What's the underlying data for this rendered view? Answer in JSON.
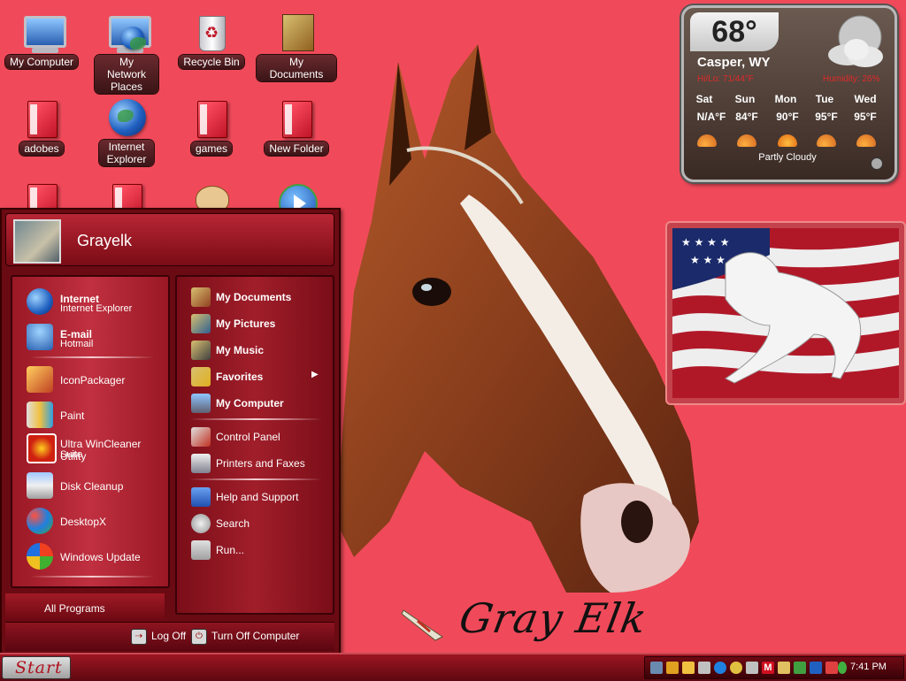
{
  "desktop": {
    "icons": [
      {
        "label": "My Computer",
        "icon": "computer-icon"
      },
      {
        "label": "My Network Places",
        "icon": "network-places-icon"
      },
      {
        "label": "Recycle Bin",
        "icon": "recycle-bin-icon"
      },
      {
        "label": "My Documents",
        "icon": "documents-icon"
      },
      {
        "label": "adobes",
        "icon": "folder-icon"
      },
      {
        "label": "Internet Explorer",
        "icon": "globe-icon"
      },
      {
        "label": "games",
        "icon": "folder-icon"
      },
      {
        "label": "New Folder",
        "icon": "folder-icon"
      }
    ],
    "signature": "Gray Elk"
  },
  "weather": {
    "temperature": "68°",
    "city": "Casper, WY",
    "high_low": "Hi/Lo: 71/44°F",
    "humidity": "Humidity: 26%",
    "forecast": [
      {
        "day": "Sat",
        "temp": "N/A°F"
      },
      {
        "day": "Sun",
        "temp": "84°F"
      },
      {
        "day": "Mon",
        "temp": "90°F"
      },
      {
        "day": "Tue",
        "temp": "95°F"
      },
      {
        "day": "Wed",
        "temp": "95°F"
      }
    ],
    "condition": "Partly Cloudy",
    "colors": {
      "accent": "#e02a2a"
    }
  },
  "start_menu": {
    "user": "Grayelk",
    "pinned": [
      {
        "title": "Internet",
        "subtitle": "Internet Explorer",
        "icon": "internet-explorer-icon"
      },
      {
        "title": "E-mail",
        "subtitle": "Hotmail",
        "icon": "email-icon"
      }
    ],
    "recent": [
      {
        "title": "IconPackager",
        "icon": "iconpackager-icon"
      },
      {
        "title": "Paint",
        "icon": "paint-icon"
      },
      {
        "title": "Ultra WinCleaner Utility",
        "subtitle": "Suite",
        "icon": "wincleaner-icon"
      },
      {
        "title": "Disk Cleanup",
        "icon": "disk-cleanup-icon"
      },
      {
        "title": "DesktopX",
        "icon": "desktopx-icon"
      },
      {
        "title": "Windows Update",
        "icon": "windows-update-icon"
      }
    ],
    "all_programs": "All Programs",
    "right": [
      {
        "label": "My Documents",
        "bold": true,
        "icon": "my-documents-icon"
      },
      {
        "label": "My Pictures",
        "bold": true,
        "icon": "my-pictures-icon"
      },
      {
        "label": "My Music",
        "bold": true,
        "icon": "my-music-icon"
      },
      {
        "label": "Favorites",
        "bold": true,
        "icon": "favorites-icon"
      },
      {
        "label": "My Computer",
        "bold": true,
        "icon": "my-computer-icon"
      },
      {
        "label": "Control Panel",
        "bold": false,
        "icon": "control-panel-icon"
      },
      {
        "label": "Printers and Faxes",
        "bold": false,
        "icon": "printer-icon"
      },
      {
        "label": "Help and Support",
        "bold": false,
        "icon": "help-icon"
      },
      {
        "label": "Search",
        "bold": false,
        "icon": "search-icon"
      },
      {
        "label": "Run...",
        "bold": false,
        "icon": "run-icon"
      }
    ],
    "log_off": "Log Off",
    "turn_off": "Turn Off Computer"
  },
  "taskbar": {
    "start_label": "Start",
    "clock": "7:41 PM"
  }
}
